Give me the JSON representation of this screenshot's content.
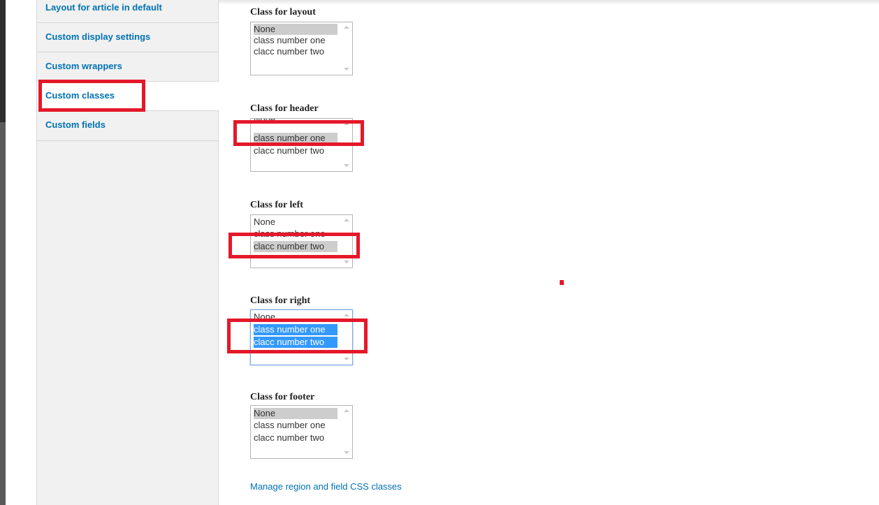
{
  "sidebar": {
    "tabs": [
      {
        "label": "Layout for article in default"
      },
      {
        "label": "Custom display settings"
      },
      {
        "label": "Custom wrappers"
      },
      {
        "label": "Custom classes"
      },
      {
        "label": "Custom fields"
      }
    ],
    "active_tab": "Custom classes"
  },
  "fields": [
    {
      "label": "Class for layout",
      "options": [
        "None",
        "class number one",
        "clacc number two"
      ],
      "selected": [
        "None"
      ],
      "focused": false
    },
    {
      "label": "Class for header",
      "options": [
        "None",
        "class number one",
        "clacc number two"
      ],
      "selected": [
        "class number one"
      ],
      "focused": false
    },
    {
      "label": "Class for left",
      "options": [
        "None",
        "class number one",
        "clacc number two"
      ],
      "selected": [
        "clacc number two"
      ],
      "focused": false
    },
    {
      "label": "Class for right",
      "options": [
        "None",
        "class number one",
        "clacc number two"
      ],
      "selected": [
        "class number one",
        "clacc number two"
      ],
      "focused": true
    },
    {
      "label": "Class for footer",
      "options": [
        "None",
        "class number one",
        "clacc number two"
      ],
      "selected": [
        "None"
      ],
      "focused": false
    }
  ],
  "links": {
    "manage": "Manage region and field CSS classes"
  },
  "colors": {
    "annotation": "#e4182a",
    "link": "#0071b3",
    "selection_focus": "#3399ff",
    "selection_inactive": "#cdcdcd"
  }
}
